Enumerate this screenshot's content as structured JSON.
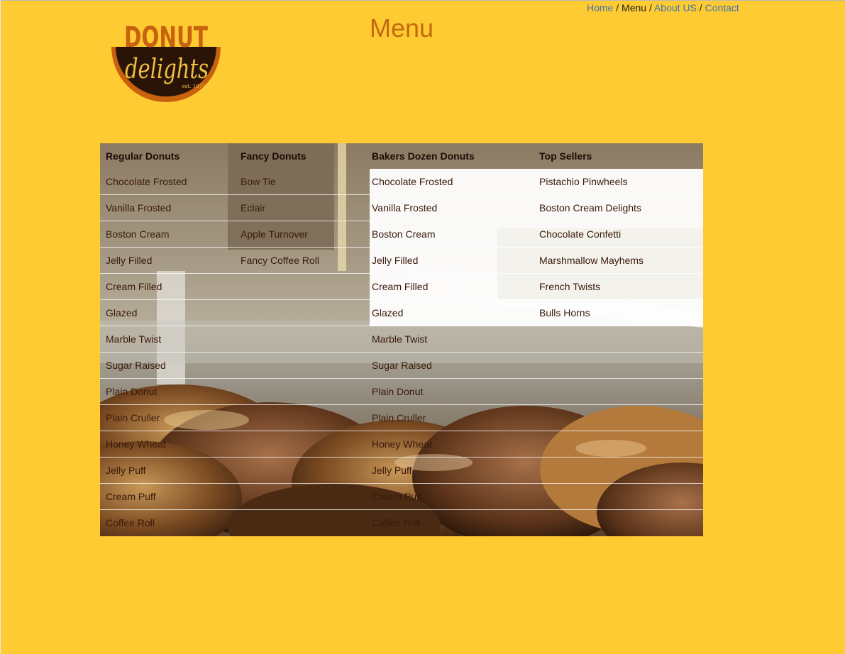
{
  "brand": {
    "logo_top": "DONUT",
    "logo_script": "delights",
    "logo_est": "est. 1971"
  },
  "header": {
    "title": "Menu"
  },
  "nav": {
    "items": [
      {
        "label": "Home",
        "current": false
      },
      {
        "label": "Menu",
        "current": true
      },
      {
        "label": "About US",
        "current": false
      },
      {
        "label": "Contact",
        "current": false
      }
    ],
    "separator": "/"
  },
  "menu_table": {
    "headers": [
      "Regular Donuts",
      "Fancy Donuts",
      "Bakers Dozen Donuts",
      "Top Sellers"
    ],
    "rows": [
      [
        "Chocolate Frosted",
        "Bow Tie",
        "Chocolate Frosted",
        "Pistachio Pinwheels"
      ],
      [
        "Vanilla Frosted",
        "Eclair",
        "Vanilla Frosted",
        "Boston Cream Delights"
      ],
      [
        "Boston Cream",
        "Apple Turnover",
        "Boston Cream",
        "Chocolate Confetti"
      ],
      [
        "Jelly Filled",
        "Fancy Coffee Roll",
        "Jelly Filled",
        "Marshmallow Mayhems"
      ],
      [
        "Cream Filled",
        "",
        "Cream Filled",
        "French Twists"
      ],
      [
        "Glazed",
        "",
        "Glazed",
        "Bulls Horns"
      ],
      [
        "Marble Twist",
        "",
        "Marble Twist",
        ""
      ],
      [
        "Sugar Raised",
        "",
        "Sugar Raised",
        ""
      ],
      [
        "Plain Donut",
        "",
        "Plain Donut",
        ""
      ],
      [
        "Plain Cruller",
        "",
        "Plain Cruller",
        ""
      ],
      [
        "Honey Wheat",
        "",
        "Honey Wheat",
        ""
      ],
      [
        "Jelly Puff",
        "",
        "Jelly Puff",
        ""
      ],
      [
        "Cream Puff",
        "",
        "Cream Puff",
        ""
      ],
      [
        "Coffee Roll",
        "",
        "Coffee Roll",
        ""
      ]
    ]
  },
  "colors": {
    "page_bg": "#ffcb32",
    "title": "#c46a10",
    "link": "#3e73b0",
    "logo_brown": "#2a1408",
    "logo_orange": "#c8620e",
    "logo_gold": "#f0c040"
  }
}
